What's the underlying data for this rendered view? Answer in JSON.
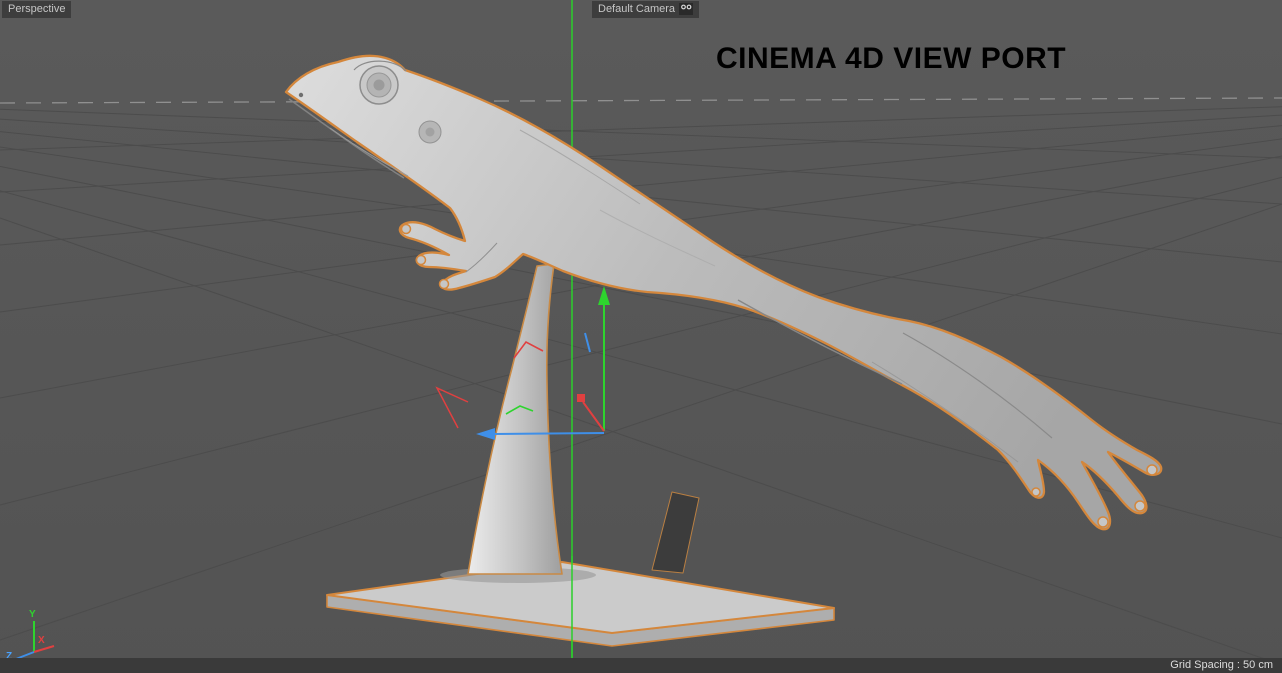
{
  "viewport": {
    "view_label": "Perspective",
    "camera_label": "Default Camera",
    "overlay_title": "CINEMA 4D VIEW PORT",
    "grid_spacing_label": "Grid Spacing : 50 cm"
  },
  "axis_indicator": {
    "x": "X",
    "y": "Y",
    "z": "Z"
  },
  "icons": {
    "camera_settings": "camera-settings-icon"
  },
  "colors": {
    "viewport_background": "#575757",
    "grid_line": "#4c4c4c",
    "horizon_line": "#969696",
    "selection_outline": "#d4873c",
    "axis_x": "#e04040",
    "axis_y": "#2ed42e",
    "axis_z": "#3f8fe8",
    "hud_label_bg": "#3d3d3d",
    "hud_label_text": "#c6c6c6",
    "status_bar_bg": "#3a3a3a",
    "title_text": "#000000",
    "model_gray": "#bdbdbd"
  }
}
